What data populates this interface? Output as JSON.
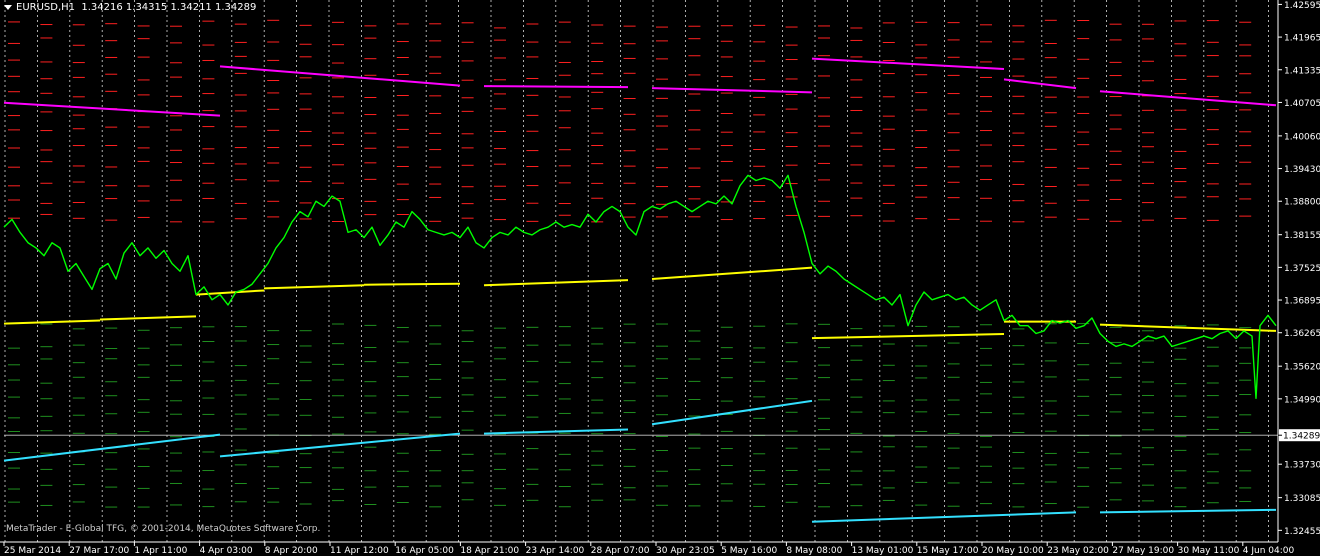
{
  "header": {
    "symbol": "EURUSD,H1",
    "ohlc": "1.34216 1.34315 1.34211 1.34289"
  },
  "copyright": "MetaTrader - E-Global TFG, © 2001-2014, MetaQuotes Software Corp.",
  "colors": {
    "background": "#000000",
    "price_line": "#00ff00",
    "pivot_line": "#ffff00",
    "resistance_line": "#ff00ff",
    "support_line": "#33e0ff",
    "resistance_levels": "#ff2020",
    "support_levels": "#1f8f1f",
    "grid": "#ffffff",
    "axis_text": "#ffffff"
  },
  "chart_data": {
    "type": "line",
    "symbol": "EURUSD",
    "timeframe": "H1",
    "grid": true,
    "ylim": [
      1.3223,
      1.4268
    ],
    "price_axis_ticks": [
      "1.42595",
      "1.41965",
      "1.41335",
      "1.40705",
      "1.40060",
      "1.39430",
      "1.38800",
      "1.38155",
      "1.37525",
      "1.36895",
      "1.36265",
      "1.35620",
      "1.34990",
      "1.34289",
      "1.33730",
      "1.33085",
      "1.32455"
    ],
    "current_price": "1.34289",
    "time_axis_labels": [
      "25 Mar 2014",
      "27 Mar 17:00",
      "1 Apr 11:00",
      "4 Apr 03:00",
      "8 Apr 20:00",
      "11 Apr 12:00",
      "16 Apr 05:00",
      "18 Apr 21:00",
      "23 Apr 14:00",
      "28 Apr 07:00",
      "30 Apr 23:05",
      "5 May 16:00",
      "8 May 08:00",
      "13 May 01:00",
      "15 May 17:00",
      "20 May 10:00",
      "23 May 02:00",
      "27 May 19:00",
      "30 May 11:00",
      "4 Jun 04:00"
    ],
    "price_series": {
      "x": [
        0,
        8,
        16,
        24,
        32,
        40,
        48,
        56,
        64,
        72,
        80,
        88,
        96,
        104,
        112,
        120,
        128,
        136,
        144,
        152,
        160,
        168,
        176,
        184,
        192,
        200,
        208,
        216,
        224,
        232,
        240,
        248,
        256,
        264,
        272,
        280,
        288,
        296,
        304,
        312,
        320,
        328,
        336,
        344,
        352,
        360,
        368,
        376,
        384,
        392,
        400,
        408,
        416,
        424,
        432,
        440,
        448,
        456,
        464,
        472,
        480,
        488,
        496,
        504,
        512,
        520,
        528,
        536,
        544,
        552,
        560,
        568,
        576,
        584,
        592,
        600,
        608,
        616,
        624,
        632,
        640,
        648,
        656,
        664,
        672,
        680,
        688,
        696,
        704,
        712,
        720,
        728,
        736,
        744,
        752,
        760,
        768,
        776,
        784,
        792,
        800,
        808,
        816,
        824,
        832,
        840,
        848,
        856,
        864,
        872,
        880,
        888,
        896,
        904,
        912,
        920,
        928,
        936,
        944,
        952,
        960,
        968,
        976,
        984,
        992,
        1000,
        1008,
        1016,
        1024,
        1032,
        1040,
        1048,
        1056,
        1064,
        1072,
        1080,
        1088,
        1096,
        1104,
        1112,
        1120,
        1128,
        1136,
        1144,
        1152,
        1160,
        1168,
        1176,
        1184,
        1192,
        1200,
        1208,
        1216,
        1224,
        1232,
        1240,
        1248,
        1252,
        1256,
        1264,
        1272
      ],
      "values": [
        1.383,
        1.3845,
        1.382,
        1.38,
        1.379,
        1.3775,
        1.38,
        1.379,
        1.3745,
        1.376,
        1.3735,
        1.371,
        1.375,
        1.376,
        1.373,
        1.378,
        1.38,
        1.3775,
        1.379,
        1.377,
        1.3785,
        1.376,
        1.3745,
        1.3775,
        1.37,
        1.3715,
        1.369,
        1.37,
        1.368,
        1.3705,
        1.371,
        1.372,
        1.374,
        1.376,
        1.379,
        1.381,
        1.384,
        1.386,
        1.385,
        1.388,
        1.387,
        1.389,
        1.388,
        1.382,
        1.3825,
        1.381,
        1.383,
        1.3795,
        1.3815,
        1.384,
        1.383,
        1.386,
        1.3845,
        1.3825,
        1.382,
        1.3815,
        1.382,
        1.381,
        1.383,
        1.38,
        1.379,
        1.381,
        1.382,
        1.3815,
        1.383,
        1.382,
        1.3815,
        1.3825,
        1.383,
        1.384,
        1.383,
        1.3835,
        1.383,
        1.3855,
        1.384,
        1.386,
        1.387,
        1.386,
        1.383,
        1.3815,
        1.386,
        1.387,
        1.3865,
        1.3875,
        1.388,
        1.387,
        1.386,
        1.387,
        1.388,
        1.3875,
        1.389,
        1.3875,
        1.391,
        1.393,
        1.392,
        1.3925,
        1.392,
        1.3905,
        1.393,
        1.387,
        1.382,
        1.376,
        1.374,
        1.3755,
        1.3745,
        1.373,
        1.372,
        1.371,
        1.37,
        1.369,
        1.3695,
        1.368,
        1.37,
        1.364,
        1.368,
        1.3705,
        1.369,
        1.3695,
        1.37,
        1.369,
        1.3695,
        1.368,
        1.367,
        1.368,
        1.369,
        1.365,
        1.366,
        1.364,
        1.364,
        1.3625,
        1.363,
        1.365,
        1.3645,
        1.365,
        1.3635,
        1.364,
        1.3655,
        1.3625,
        1.361,
        1.36,
        1.3605,
        1.36,
        1.361,
        1.362,
        1.3615,
        1.362,
        1.36,
        1.3605,
        1.361,
        1.3615,
        1.362,
        1.3615,
        1.3625,
        1.363,
        1.3615,
        1.363,
        1.362,
        1.35,
        1.364,
        1.366,
        1.364
      ]
    },
    "pivot_line": {
      "segments": [
        {
          "x": [
            0,
            96
          ],
          "values": [
            1.3644,
            1.365
          ]
        },
        {
          "x": [
            96,
            192
          ],
          "values": [
            1.3652,
            1.3658
          ]
        },
        {
          "x": [
            192,
            260
          ],
          "values": [
            1.37,
            1.3708
          ]
        },
        {
          "x": [
            260,
            360
          ],
          "values": [
            1.3712,
            1.3718
          ]
        },
        {
          "x": [
            360,
            456
          ],
          "values": [
            1.3719,
            1.3721
          ]
        },
        {
          "x": [
            480,
            624
          ],
          "values": [
            1.3718,
            1.3728
          ]
        },
        {
          "x": [
            648,
            808
          ],
          "values": [
            1.373,
            1.3752
          ]
        },
        {
          "x": [
            808,
            1000
          ],
          "values": [
            1.3616,
            1.3624
          ]
        },
        {
          "x": [
            1000,
            1072
          ],
          "values": [
            1.3648,
            1.3648
          ]
        },
        {
          "x": [
            1096,
            1272
          ],
          "values": [
            1.3642,
            1.363
          ]
        }
      ]
    },
    "resistance_line": {
      "segments": [
        {
          "x": [
            0,
            216
          ],
          "values": [
            1.407,
            1.4045
          ]
        },
        {
          "x": [
            216,
            456
          ],
          "values": [
            1.414,
            1.4103
          ]
        },
        {
          "x": [
            480,
            624
          ],
          "values": [
            1.4102,
            1.41
          ]
        },
        {
          "x": [
            648,
            808
          ],
          "values": [
            1.4098,
            1.409
          ]
        },
        {
          "x": [
            808,
            1000
          ],
          "values": [
            1.4155,
            1.4135
          ]
        },
        {
          "x": [
            1000,
            1072
          ],
          "values": [
            1.4115,
            1.4098
          ]
        },
        {
          "x": [
            1096,
            1272
          ],
          "values": [
            1.4092,
            1.4065
          ]
        }
      ]
    },
    "support_line": {
      "segments": [
        {
          "x": [
            0,
            216
          ],
          "values": [
            1.338,
            1.343
          ]
        },
        {
          "x": [
            216,
            456
          ],
          "values": [
            1.3388,
            1.3432
          ]
        },
        {
          "x": [
            480,
            624
          ],
          "values": [
            1.3432,
            1.344
          ]
        },
        {
          "x": [
            648,
            808
          ],
          "values": [
            1.345,
            1.3495
          ]
        },
        {
          "x": [
            808,
            1072
          ],
          "values": [
            1.3262,
            1.328
          ]
        },
        {
          "x": [
            1096,
            1272
          ],
          "values": [
            1.328,
            1.3285
          ]
        }
      ]
    }
  }
}
